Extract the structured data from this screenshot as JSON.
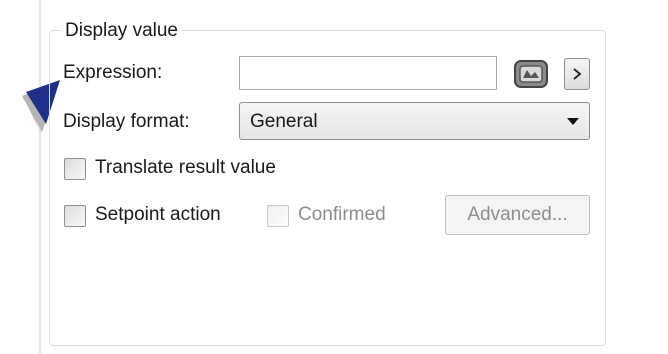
{
  "group": {
    "title": "Display value"
  },
  "expression": {
    "label": "Expression:",
    "value": "",
    "browse_icon": "browse-icon",
    "arrow_icon": "chevron-right-icon"
  },
  "display_format": {
    "label": "Display format:",
    "selected": "General"
  },
  "translate": {
    "label": "Translate result value",
    "checked": false
  },
  "setpoint": {
    "label": "Setpoint action",
    "checked": false
  },
  "confirmed": {
    "label": "Confirmed",
    "checked": false,
    "enabled": false
  },
  "advanced": {
    "label": "Advanced...",
    "enabled": false
  },
  "colors": {
    "pointer": "#1f2f8a",
    "group_border": "#d5dfe5",
    "disabled_text": "#8d8d8d"
  }
}
